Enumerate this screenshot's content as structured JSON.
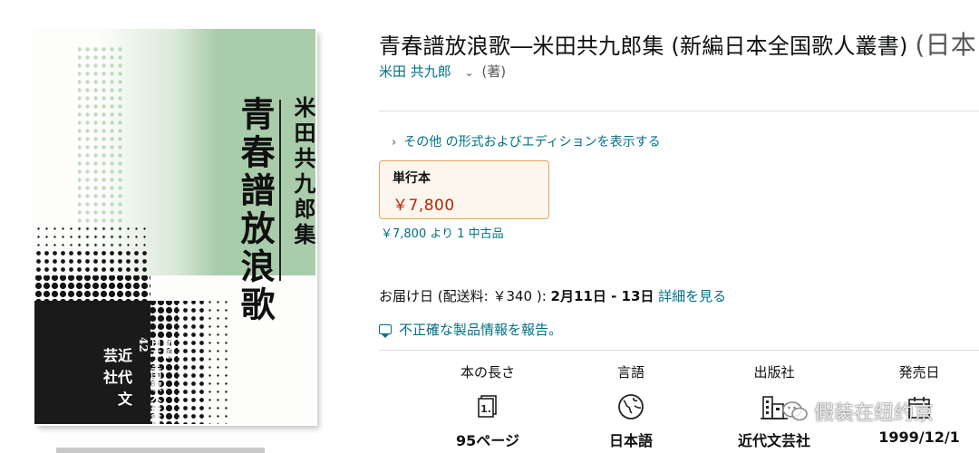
{
  "cover": {
    "title": "青春譜放浪歌",
    "author": "米田共九郎集",
    "series_1": "新編",
    "series_2": "日本全国歌人叢書42",
    "publisher": "近代文芸社",
    "colors": {
      "green": "#a9ccaa",
      "dark": "#1a1a1a",
      "paper": "#fdfdfb"
    }
  },
  "product": {
    "title": "青春譜放浪歌―米田共九郎集 (新編日本全国歌人叢書)",
    "title_format": "(日本",
    "author_link": "米田 共九郎",
    "author_role": "(著)",
    "other_formats": "その他 の形式およびエディションを表示する",
    "format_label": "単行本",
    "format_price": "￥7,800",
    "used_offer": "￥7,800 より 1 中古品",
    "delivery_prefix": "お届け日 (配送料: ￥340 ):",
    "delivery_dates": "2月11日 - 13日",
    "delivery_link": "詳細を見る",
    "report_link": "不正確な製品情報を報告。"
  },
  "attributes": [
    {
      "name": "本の長さ",
      "icon": "page-count-icon",
      "value": "95ページ"
    },
    {
      "name": "言語",
      "icon": "globe-icon",
      "value": "日本語"
    },
    {
      "name": "出版社",
      "icon": "building-icon",
      "value": "近代文芸社"
    },
    {
      "name": "発売日",
      "icon": "calendar-icon",
      "value": "1999/12/1"
    }
  ],
  "watermark": {
    "text": "假装在纽约京"
  },
  "colors": {
    "link": "#007185",
    "price": "#b12704",
    "box_border": "#e4a256",
    "box_bg": "#fdf6ee"
  }
}
